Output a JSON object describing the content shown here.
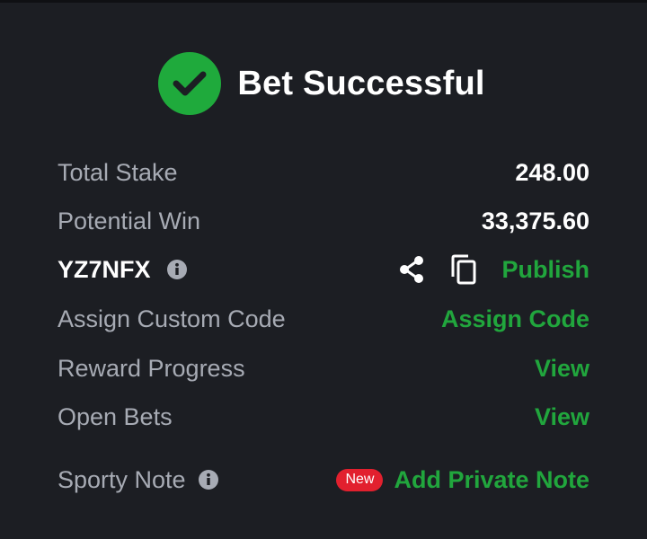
{
  "header": {
    "title": "Bet Successful",
    "icon": "check-circle-icon",
    "icon_color": "#1faa3c"
  },
  "rows": {
    "total_stake": {
      "label": "Total Stake",
      "value": "248.00"
    },
    "potential_win": {
      "label": "Potential Win",
      "value": "33,375.60"
    },
    "booking": {
      "code": "YZ7NFX",
      "info_icon": "info-icon",
      "share_icon": "share-icon",
      "copy_icon": "copy-icon",
      "action": "Publish"
    },
    "custom_code": {
      "label": "Assign Custom Code",
      "action": "Assign Code"
    },
    "reward_progress": {
      "label": "Reward Progress",
      "action": "View"
    },
    "open_bets": {
      "label": "Open Bets",
      "action": "View"
    },
    "sporty_note": {
      "label": "Sporty Note",
      "info_icon": "info-icon",
      "badge": "New",
      "action": "Add Private Note"
    }
  },
  "colors": {
    "background": "#1c1e23",
    "accent_green": "#21a63d",
    "badge_red": "#e2202e",
    "muted_text": "#a7abb4"
  }
}
